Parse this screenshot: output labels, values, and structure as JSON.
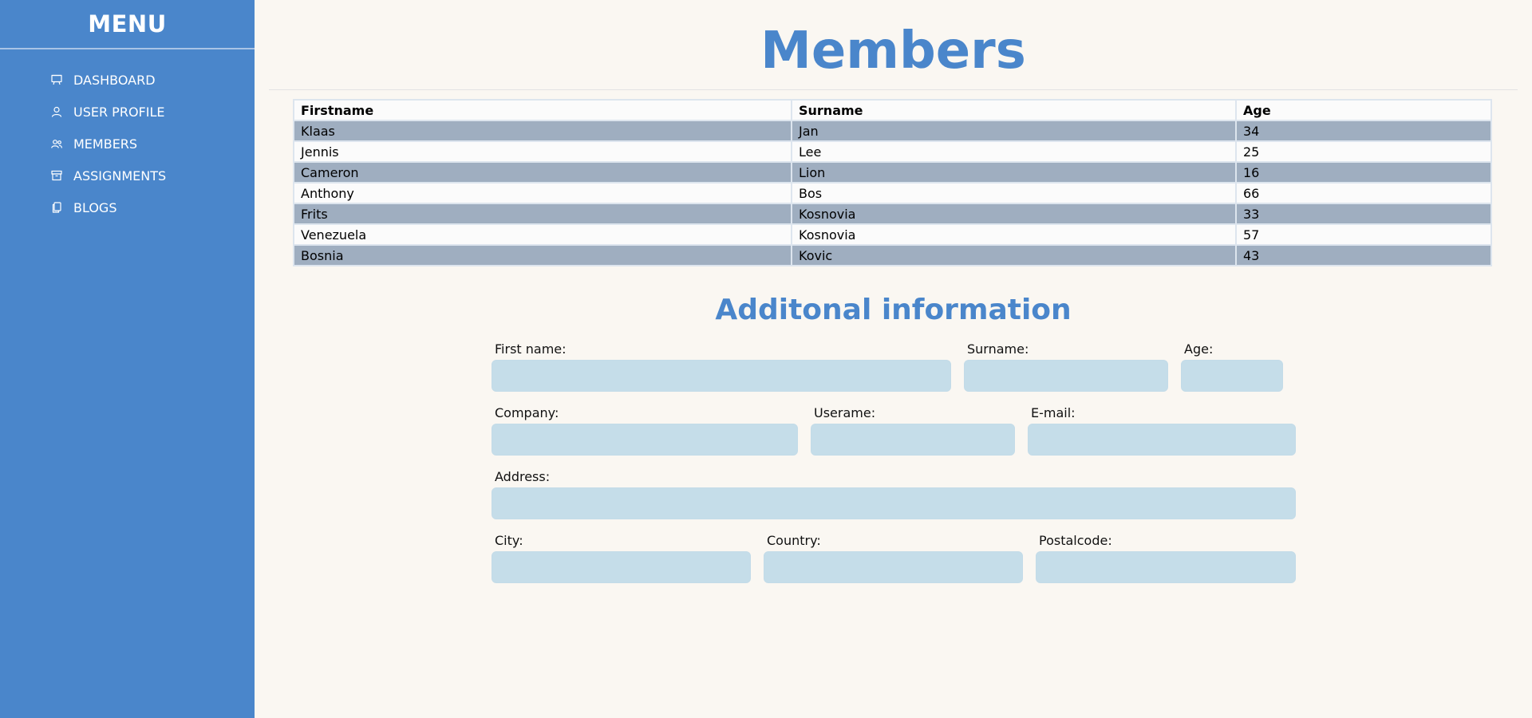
{
  "sidebar": {
    "title": "MENU",
    "items": [
      {
        "label": "DASHBOARD",
        "icon": "presentation-board-icon"
      },
      {
        "label": "USER PROFILE",
        "icon": "user-icon"
      },
      {
        "label": "MEMBERS",
        "icon": "users-icon"
      },
      {
        "label": "ASSIGNMENTS",
        "icon": "archive-box-icon"
      },
      {
        "label": "BLOGS",
        "icon": "document-copy-icon"
      }
    ]
  },
  "main": {
    "title": "Members",
    "table": {
      "headers": [
        "Firstname",
        "Surname",
        "Age"
      ],
      "rows": [
        [
          "Klaas",
          "Jan",
          "34"
        ],
        [
          "Jennis",
          "Lee",
          "25"
        ],
        [
          "Cameron",
          "Lion",
          "16"
        ],
        [
          "Anthony",
          "Bos",
          "66"
        ],
        [
          "Frits",
          "Kosnovia",
          "33"
        ],
        [
          "Venezuela",
          "Kosnovia",
          "57"
        ],
        [
          "Bosnia",
          "Kovic",
          "43"
        ]
      ]
    },
    "form": {
      "title": "Additonal information",
      "fields": {
        "first_name": {
          "label": "First name:",
          "value": ""
        },
        "surname": {
          "label": "Surname:",
          "value": ""
        },
        "age": {
          "label": "Age:",
          "value": ""
        },
        "company": {
          "label": "Company:",
          "value": ""
        },
        "username": {
          "label": "Userame:",
          "value": ""
        },
        "email": {
          "label": "E-mail:",
          "value": ""
        },
        "address": {
          "label": "Address:",
          "value": ""
        },
        "city": {
          "label": "City:",
          "value": ""
        },
        "country": {
          "label": "Country:",
          "value": ""
        },
        "postalcode": {
          "label": "Postalcode:",
          "value": ""
        }
      }
    }
  },
  "colors": {
    "sidebar_bg": "#4a86cb",
    "accent": "#4a86cb",
    "page_bg": "#faf7f2",
    "row_stripe": "#9faec0",
    "input_bg": "#c5dde9"
  }
}
